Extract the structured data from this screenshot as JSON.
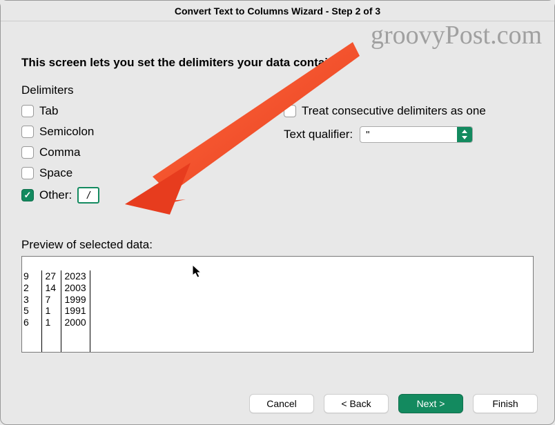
{
  "title": "Convert Text to Columns Wizard - Step 2 of 3",
  "watermark": "groovyPost.com",
  "instruction": "This screen lets you set the delimiters your data contains.",
  "delimiters": {
    "label": "Delimiters",
    "items": [
      {
        "label": "Tab",
        "checked": false
      },
      {
        "label": "Semicolon",
        "checked": false
      },
      {
        "label": "Comma",
        "checked": false
      },
      {
        "label": "Space",
        "checked": false
      },
      {
        "label": "Other:",
        "checked": true
      }
    ],
    "other_value": "/"
  },
  "treat_consecutive": {
    "label": "Treat consecutive delimiters as one",
    "checked": false
  },
  "text_qualifier": {
    "label": "Text qualifier:",
    "value": "\""
  },
  "preview": {
    "label": "Preview of selected data:",
    "rows": [
      [
        "9",
        "27",
        "2023"
      ],
      [
        "2",
        "14",
        "2003"
      ],
      [
        "3",
        "7",
        "1999"
      ],
      [
        "5",
        "1",
        "1991"
      ],
      [
        "6",
        "1",
        "2000"
      ]
    ]
  },
  "buttons": {
    "cancel": "Cancel",
    "back": "< Back",
    "next": "Next >",
    "finish": "Finish"
  }
}
